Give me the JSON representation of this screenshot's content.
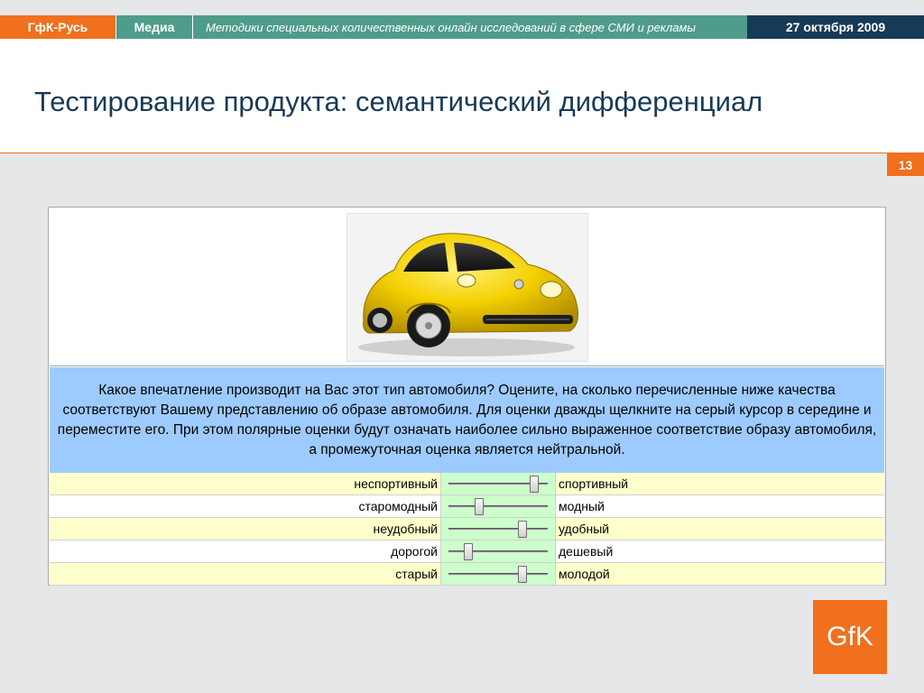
{
  "header": {
    "brand": "ГфК-Русь",
    "section": "Медиа",
    "description": "Методики специальных количественных онлайн исследований в сфере СМИ и рекламы",
    "date": "27 октября 2009"
  },
  "title": "Тестирование продукта: семантический дифференциал",
  "slide_number": "13",
  "survey": {
    "question": "Какое впечатление производит на Вас этот тип автомобиля? Оцените, на сколько перечисленные ниже качества соответствуют Вашему представлению об образе автомобиля. Для оценки дважды щелкните на серый курсор в середине и переместите его. При этом полярные оценки будут означать наиболее сильно выраженное соответствие образу автомобиля, а промежуточная оценка является нейтральной.",
    "scales": [
      {
        "left": "неспортивный",
        "right": "спортивный",
        "value": 0.85
      },
      {
        "left": "старомодный",
        "right": "модный",
        "value": 0.3
      },
      {
        "left": "неудобный",
        "right": "удобный",
        "value": 0.73
      },
      {
        "left": "дорогой",
        "right": "дешевый",
        "value": 0.2
      },
      {
        "left": "старый",
        "right": "молодой",
        "value": 0.73
      }
    ]
  },
  "logo": "GfK",
  "colors": {
    "brand_orange": "#f0701e",
    "teal": "#4f9c8a",
    "navy": "#173a57",
    "question_bg": "#9ecbff",
    "row_yellow": "#ffffcc",
    "slider_green": "#ccffcc",
    "car_yellow": "#f4d000"
  },
  "icons": {
    "car_image": "yellow-car-image"
  }
}
